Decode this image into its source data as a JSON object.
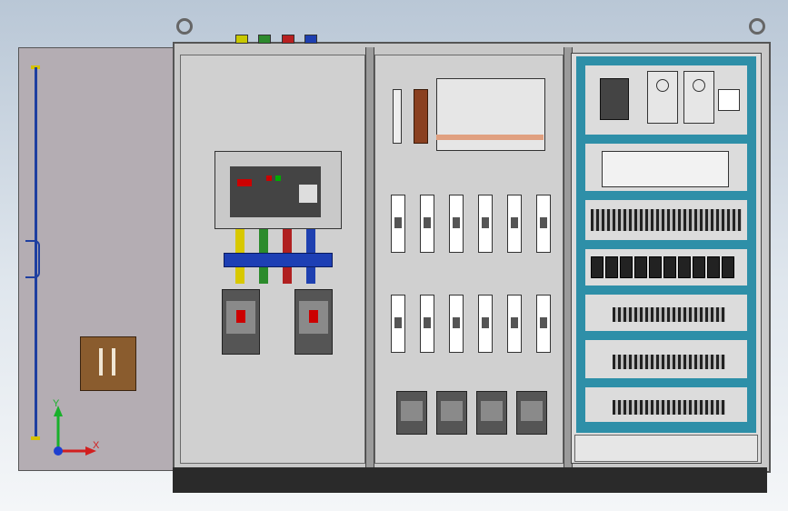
{
  "viewport": {
    "background": "gradient-gray-blue"
  },
  "cabinet": {
    "door_color": "#b4adb3",
    "frame_color": "#c8c8c8",
    "duct_color": "#2e8fa8",
    "color_tags": [
      {
        "color": "#c8c800"
      },
      {
        "color": "#2d8a2d"
      },
      {
        "color": "#b82020"
      },
      {
        "color": "#1e3fb0"
      }
    ]
  },
  "triad": {
    "y_label": "Y",
    "x_label": "X"
  },
  "acb_panel": {
    "label": "",
    "busbar_colors": [
      "#d8c800",
      "#2b8b2b",
      "#b02020",
      "#1e40b0"
    ]
  }
}
